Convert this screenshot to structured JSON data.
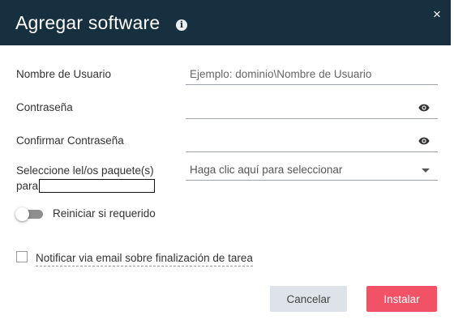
{
  "dialog": {
    "title": "Agregar software",
    "info_icon": "info-icon",
    "close_glyph": "×"
  },
  "form": {
    "username": {
      "label": "Nombre de Usuario",
      "placeholder": "Ejemplo: dominio\\Nombre de Usuario",
      "value": ""
    },
    "password": {
      "label": "Contraseña",
      "value": "",
      "icon": "eye-icon"
    },
    "confirm_password": {
      "label": "Confirmar Contraseña",
      "value": "",
      "icon": "eye-icon"
    },
    "packages": {
      "label_line1": "Seleccione lel/os paquete(s)",
      "label_line2": "para",
      "selected_text": "Haga clic aquí para seleccionar",
      "icon": "caret-down-icon"
    },
    "restart_toggle": {
      "label": "Reiniciar si requerido",
      "on": false
    },
    "notify_checkbox": {
      "label": "Notificar via email sobre finalización de tarea",
      "checked": false
    }
  },
  "buttons": {
    "cancel": "Cancelar",
    "install": "Instalar"
  },
  "colors": {
    "header_bg": "#16303f",
    "install_bg": "#f25266",
    "cancel_bg": "#dde3e8"
  }
}
